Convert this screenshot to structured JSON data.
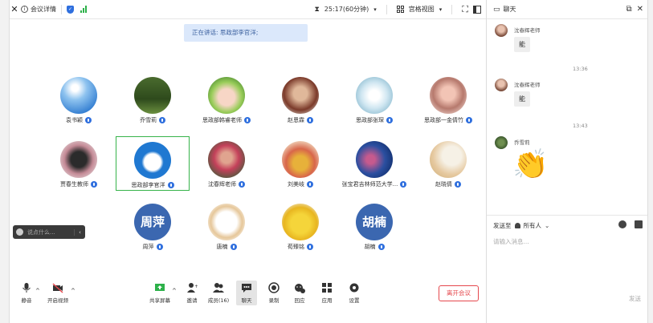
{
  "window": {
    "title": "会议详情",
    "timer": "25:17(60分钟)",
    "view_mode": "宫格视图"
  },
  "speaking": "正在讲话: 思政部李官洋;",
  "participants": [
    {
      "name": "袁书颖",
      "avatar": "sky"
    },
    {
      "name": "乔雪莉",
      "avatar": "forest"
    },
    {
      "name": "思政部韩睿老师",
      "avatar": "cartoon"
    },
    {
      "name": "赵恩霖",
      "avatar": "photo"
    },
    {
      "name": "思政部张琛",
      "avatar": "frost"
    },
    {
      "name": "思政部一金倩竹",
      "avatar": "portrait"
    },
    {
      "name": "贾春生教师",
      "avatar": "watch"
    },
    {
      "name": "思政部李官洋",
      "avatar": "doraemon"
    },
    {
      "name": "沈春辉老师",
      "avatar": "person"
    },
    {
      "name": "刘美岐",
      "avatar": "bike"
    },
    {
      "name": "张宝君吉林师范大学...",
      "avatar": "ocean"
    },
    {
      "name": "赵晓倩",
      "avatar": "child"
    },
    {
      "name": "周萍",
      "avatar": "text",
      "avatar_text": "周萍"
    },
    {
      "name": "唐楠",
      "avatar": "sketch"
    },
    {
      "name": "荀臻铭",
      "avatar": "pikachu"
    },
    {
      "name": "胡楠",
      "avatar": "text",
      "avatar_text": "胡楠"
    }
  ],
  "minichat": {
    "placeholder": "说点什么..."
  },
  "toolbar": {
    "mute": "静音",
    "video": "开启视频",
    "share": "共享屏幕",
    "invite": "邀请",
    "members": "成员(16)",
    "chat": "聊天",
    "record": "录制",
    "replay": "回应",
    "apps": "应用",
    "settings": "设置",
    "leave": "离开会议"
  },
  "chat": {
    "title": "聊天",
    "messages": [
      {
        "sender": "沈春辉老师",
        "text": "能"
      },
      {
        "time": "13:36"
      },
      {
        "sender": "沈春辉老师",
        "text": "能"
      },
      {
        "time": "13:43"
      },
      {
        "sender": "乔雪莉",
        "text": "👏"
      }
    ],
    "send_to_label": "发送至",
    "send_to_value": "所有人",
    "input_placeholder": "请输入消息...",
    "send_label": "发送"
  }
}
